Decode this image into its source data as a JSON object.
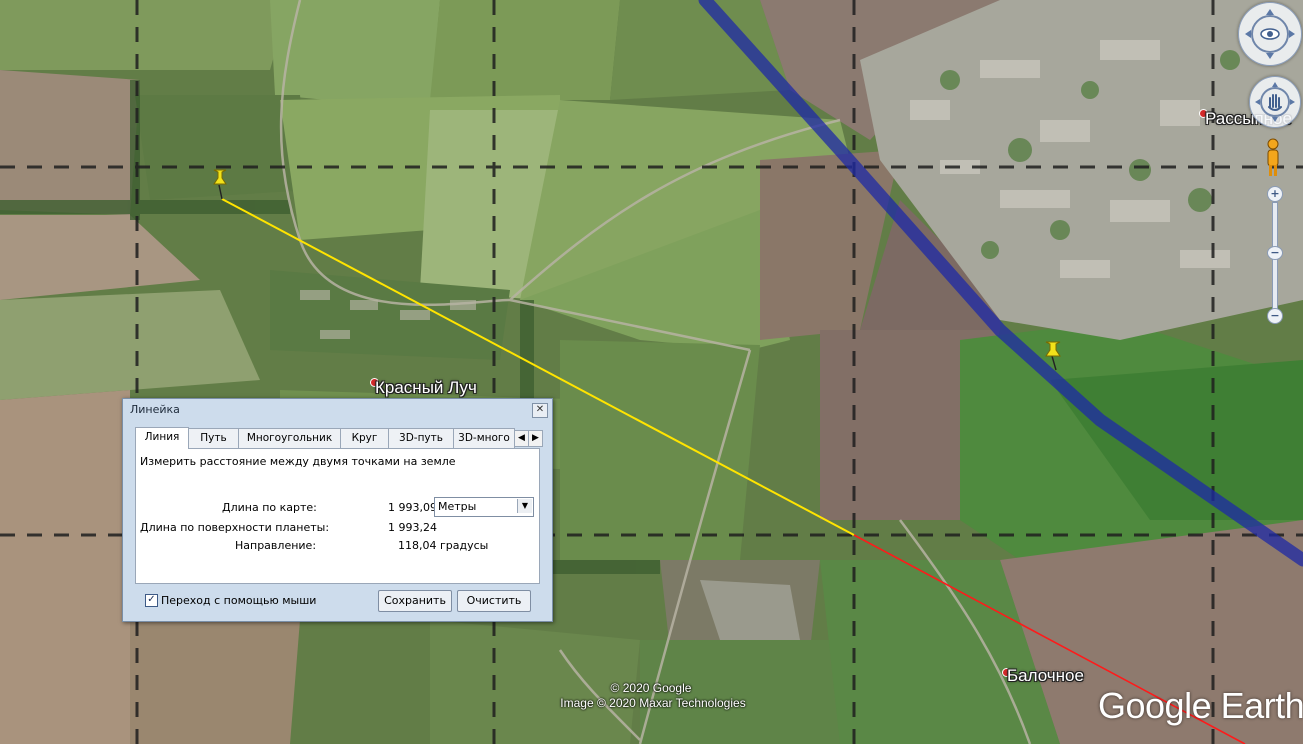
{
  "map": {
    "places": [
      {
        "name": "Красный Луч"
      },
      {
        "name": "Рассыпное"
      },
      {
        "name": "Балочное"
      }
    ],
    "credits": {
      "line1": "© 2020 Google",
      "line2": "Image © 2020 Maxar Technologies"
    },
    "brand": "Google Earth"
  },
  "ruler": {
    "title": "Линейка",
    "tabs": [
      "Линия",
      "Путь",
      "Многоугольник",
      "Круг",
      "3D-путь",
      "3D-много"
    ],
    "active_tab": "Линия",
    "description": "Измерить расстояние между двумя точками на земле",
    "map_length_label": "Длина по карте:",
    "map_length_value": "1 993,09",
    "unit": "Метры",
    "ground_length_label": "Длина по поверхности планеты:",
    "ground_length_value": "1 993,24",
    "heading_label": "Направление:",
    "heading_value": "118,04 градусы",
    "mouse_nav_label": "Переход с помощью мыши",
    "mouse_nav_checked": true,
    "save_label": "Сохранить",
    "clear_label": "Очистить"
  },
  "colors": {
    "measure_line": "#ffe400",
    "measure_extension": "#ff1a1a",
    "route_line": "#1d2aa6",
    "grid_line": "#1e1e1e",
    "pin": "#f2e21a"
  }
}
